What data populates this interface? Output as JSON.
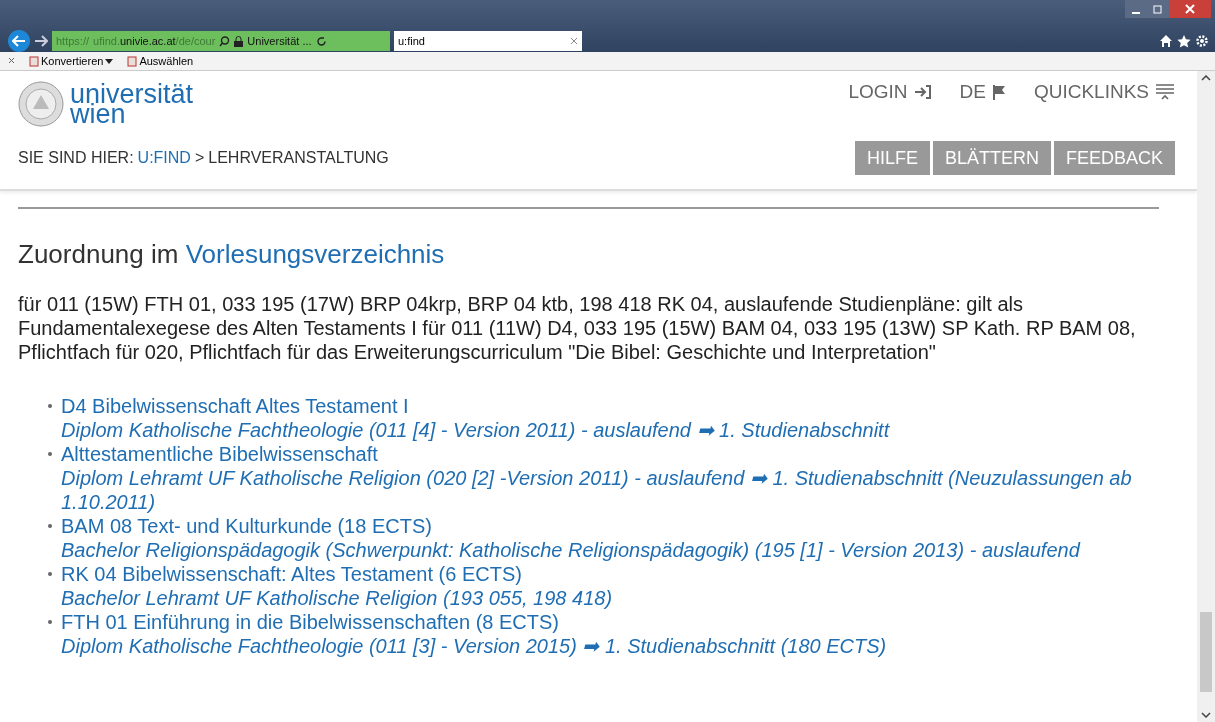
{
  "browser": {
    "address": {
      "scheme": "https://",
      "host_prefix": "ufind.",
      "host": "univie.ac.at",
      "path": "/de/cour",
      "site": "Universität ..."
    },
    "tab": {
      "title": "u:find"
    },
    "toolbar": [
      "Konvertieren",
      "Auswählen"
    ]
  },
  "header": {
    "logo": [
      "universität",
      "wien"
    ],
    "nav": [
      {
        "label": "LOGIN",
        "kind": "login"
      },
      {
        "label": "DE",
        "kind": "language"
      },
      {
        "label": "QUICKLINKS",
        "kind": "menu"
      }
    ],
    "breadcrumb": {
      "label": "SIE SIND HIER:",
      "link": "U:FIND",
      "separator": ">",
      "current": "LEHRVERANSTALTUNG"
    },
    "buttons": [
      "HILFE",
      "BLÄTTERN",
      "FEEDBACK"
    ]
  },
  "content": {
    "heading": {
      "text": "Zuordnung im",
      "link": "Vorlesungsverzeichnis"
    },
    "paragraph": "für 011 (15W) FTH 01, 033 195 (17W) BRP 04krp, BRP 04 ktb, 198 418 RK 04, auslaufende Studienpläne: gilt als Fundamentalexegese des Alten Testaments I für 011 (11W) D4, 033 195 (15W) BAM 04, 033 195 (13W) SP Kath. RP BAM 08, Pflichtfach für 020, Pflichtfach für das Erweiterungscurriculum \"Die Bibel: Geschichte und Interpretation\"",
    "items": [
      {
        "title": "D4 Bibelwissenschaft Altes Testament I",
        "detail": "Diplom Katholische Fachtheologie (011 [4] - Version 2011) - auslaufend ➡ 1. Studienabschnitt"
      },
      {
        "title": "Alttestamentliche Bibelwissenschaft",
        "detail": "Diplom Lehramt UF Katholische Religion (020 [2] -Version 2011) - auslaufend ➡ 1. Studienabschnitt (Neuzulassungen ab 1.10.2011)"
      },
      {
        "title": "BAM 08 Text- und Kulturkunde (18 ECTS)",
        "detail": "Bachelor Religionspädagogik (Schwerpunkt: Katholische Religionspädagogik) (195 [1] - Version 2013) - auslaufend"
      },
      {
        "title": "RK 04 Bibelwissenschaft: Altes Testament (6 ECTS)",
        "detail": "Bachelor Lehramt UF Katholische Religion (193 055, 198 418)"
      },
      {
        "title": "FTH 01 Einführung in die Bibelwissenschaften (8 ECTS)",
        "detail": "Diplom Katholische Fachtheologie (011 [3] - Version 2015) ➡ 1. Studienabschnitt (180 ECTS)"
      }
    ]
  }
}
